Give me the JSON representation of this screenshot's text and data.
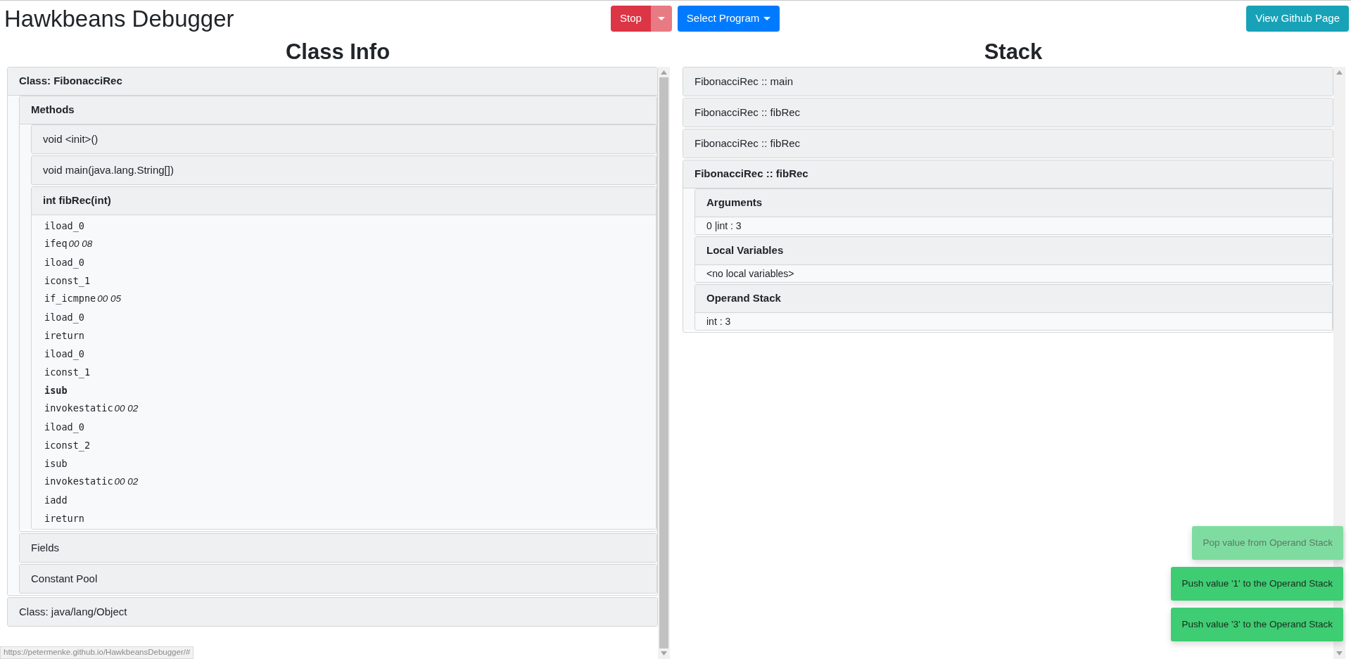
{
  "header": {
    "title": "Hawkbeans Debugger",
    "stop_button": "Stop",
    "select_program": "Select Program",
    "github_button": "View Github Page"
  },
  "class_info": {
    "heading": "Class Info",
    "nodes": [
      {
        "label": "Class: FibonacciRec",
        "expanded": true,
        "children": [
          {
            "label": "Methods",
            "expanded": true,
            "children": [
              {
                "label": "void <init>()",
                "expanded": false
              },
              {
                "label": "void main(java.lang.String[])",
                "expanded": false
              },
              {
                "label": "int fibRec(int)",
                "expanded": true,
                "instructions": [
                  {
                    "op": "iload_0",
                    "current": false
                  },
                  {
                    "op": "ifeq",
                    "args": "00 08",
                    "current": false
                  },
                  {
                    "op": "iload_0",
                    "current": false
                  },
                  {
                    "op": "iconst_1",
                    "current": false
                  },
                  {
                    "op": "if_icmpne",
                    "args": "00 05",
                    "current": false
                  },
                  {
                    "op": "iload_0",
                    "current": false
                  },
                  {
                    "op": "ireturn",
                    "current": false
                  },
                  {
                    "op": "iload_0",
                    "current": false
                  },
                  {
                    "op": "iconst_1",
                    "current": false
                  },
                  {
                    "op": "isub",
                    "current": true
                  },
                  {
                    "op": "invokestatic",
                    "args": "00 02",
                    "current": false
                  },
                  {
                    "op": "iload_0",
                    "current": false
                  },
                  {
                    "op": "iconst_2",
                    "current": false
                  },
                  {
                    "op": "isub",
                    "current": false
                  },
                  {
                    "op": "invokestatic",
                    "args": "00 02",
                    "current": false
                  },
                  {
                    "op": "iadd",
                    "current": false
                  },
                  {
                    "op": "ireturn",
                    "current": false
                  }
                ]
              }
            ]
          },
          {
            "label": "Fields",
            "expanded": false
          },
          {
            "label": "Constant Pool",
            "expanded": false
          }
        ]
      },
      {
        "label": "Class: java/lang/Object",
        "expanded": false
      }
    ]
  },
  "stack": {
    "heading": "Stack",
    "nodes": [
      {
        "label": "FibonacciRec :: main",
        "expanded": false
      },
      {
        "label": "FibonacciRec :: fibRec",
        "expanded": false
      },
      {
        "label": "FibonacciRec :: fibRec",
        "expanded": false
      },
      {
        "label": "FibonacciRec :: fibRec",
        "expanded": true,
        "children": [
          {
            "label": "Arguments",
            "expanded": true,
            "rows": [
              "0 |int : 3"
            ]
          },
          {
            "label": "Local Variables",
            "expanded": true,
            "rows": [
              "<no local variables>"
            ]
          },
          {
            "label": "Operand Stack",
            "expanded": true,
            "rows": [
              "int : 3"
            ]
          }
        ]
      }
    ]
  },
  "toasts": [
    {
      "text": "Pop value from Operand Stack",
      "faded": true
    },
    {
      "text": "Push value '1' to the Operand Stack",
      "faded": false
    },
    {
      "text": "Push value '3' to the Operand Stack",
      "faded": false
    }
  ],
  "status_url": "https://petermenke.github.io/HawkbeansDebugger/#"
}
